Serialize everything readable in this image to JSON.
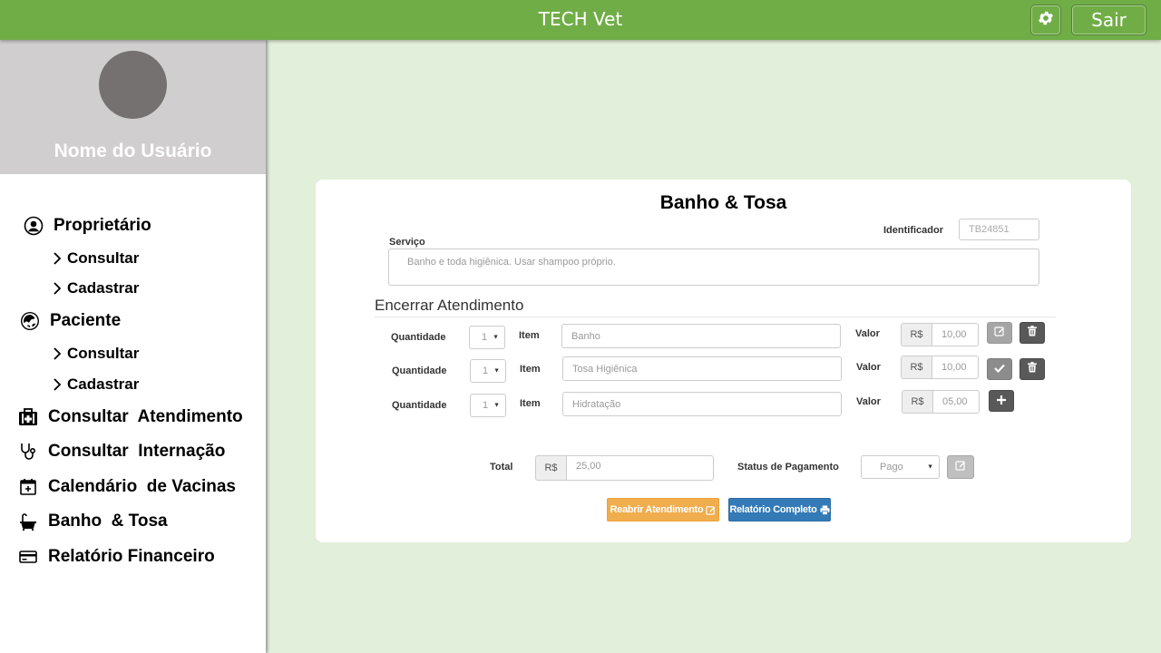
{
  "app": {
    "title": "TECH Vet"
  },
  "topbar": {
    "settings_icon": "gear-icon",
    "logout_label": "Sair"
  },
  "user": {
    "name": "Nome do Usuário"
  },
  "sidebar": {
    "proprietario": {
      "label": "Proprietário",
      "icon": "user-circle-icon",
      "consultar": "Consultar",
      "cadastrar": "Cadastrar"
    },
    "paciente": {
      "label": "Paciente",
      "icon": "paw-icon",
      "consultar": "Consultar",
      "cadastrar": "Cadastrar"
    },
    "items": [
      {
        "label": "Consultar  Atendimento",
        "icon": "medical-kit-icon"
      },
      {
        "label": "Consultar  Internação",
        "icon": "stethoscope-icon"
      },
      {
        "label": "Calendário  de Vacinas",
        "icon": "calendar-plus-icon"
      },
      {
        "label": "Banho  & Tosa",
        "icon": "bathtub-icon"
      },
      {
        "label": "Relatório Financeiro",
        "icon": "credit-card-icon"
      }
    ]
  },
  "form": {
    "title": "Banho & Tosa",
    "identificador_label": "Identificador",
    "identificador_value": "TB24851",
    "servico_label": "Serviço",
    "servico_value": "Banho e toda higiênica. Usar shampoo próprio.",
    "section_title": "Encerrar Atendimento",
    "rows": [
      {
        "qty_label": "Quantidade",
        "qty": "1",
        "item_label": "Item",
        "item": "Banho",
        "valor_label": "Valor",
        "currency": "R$",
        "valor": "10,00"
      },
      {
        "qty_label": "Quantidade",
        "qty": "1",
        "item_label": "Item",
        "item": "Tosa Higiênica",
        "valor_label": "Valor",
        "currency": "R$",
        "valor": "10,00"
      },
      {
        "qty_label": "Quantidade",
        "qty": "1",
        "item_label": "Item",
        "item": "Hidratação",
        "valor_label": "Valor",
        "currency": "R$",
        "valor": "05,00"
      }
    ],
    "total_label": "Total",
    "total_currency": "R$",
    "total_value": "25,00",
    "status_label": "Status de Pagamento",
    "status_value": "Pago",
    "reopen_label": "Reabrir Atendimento",
    "report_label": "Relatório Completo"
  },
  "colors": {
    "topbar": "#70ad47",
    "background": "#e2efda",
    "reopen_button": "#f0ad4e",
    "report_button": "#337ab7"
  }
}
